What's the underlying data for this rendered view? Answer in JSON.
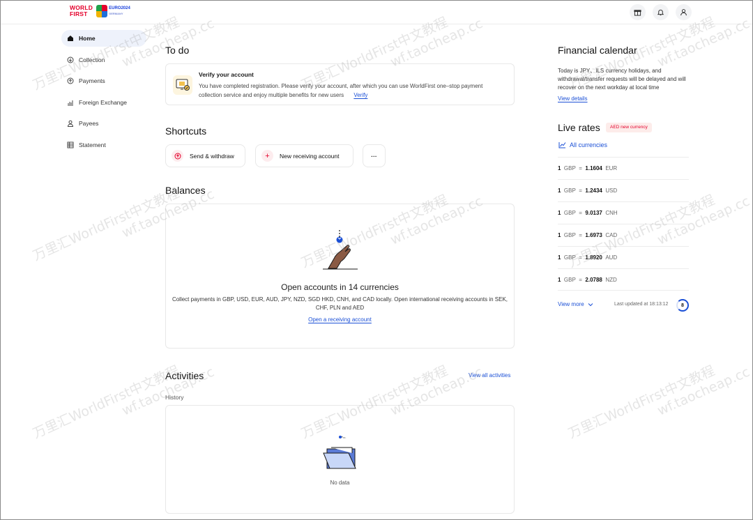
{
  "header": {
    "logo_line1": "WORLD",
    "logo_line2": "FIRST",
    "euro_line1": "EURO2024",
    "euro_line2": "GERMANY"
  },
  "sidebar": {
    "items": [
      {
        "label": "Home"
      },
      {
        "label": "Collection"
      },
      {
        "label": "Payments"
      },
      {
        "label": "Foreign Exchange"
      },
      {
        "label": "Payees"
      },
      {
        "label": "Statement"
      }
    ]
  },
  "todo": {
    "title": "To do",
    "item_title": "Verify your account",
    "item_desc": "You have completed registration. Please verify your account, after which you can use WorldFirst one–stop payment collection service and enjoy multiple benefits for new users",
    "verify_label": "Verify"
  },
  "shortcuts": {
    "title": "Shortcuts",
    "send_withdraw": "Send & withdraw",
    "new_receiving": "New receiving account",
    "more": "···"
  },
  "balances": {
    "title": "Balances",
    "headline": "Open accounts in 14 currencies",
    "desc_line1": "Collect payments in GBP, USD, EUR, AUD, JPY, NZD, SGD HKD, CNH, and CAD locally. Open international receiving accounts in SEK,",
    "desc_line2": "CHF, PLN and AED",
    "cta": "Open a receiving account"
  },
  "activities": {
    "title": "Activities",
    "view_all": "View all activities",
    "history": "History",
    "empty": "No data"
  },
  "calendar": {
    "title": "Financial calendar",
    "text": "Today is JPY、ILS currency holidays, and withdrawal/transfer requests will be delayed and will recover on the next workday at local time",
    "view_details": "View details"
  },
  "rates": {
    "title": "Live rates",
    "badge": "AED new currency",
    "all_currencies": "All currencies",
    "rows": [
      {
        "amount": "1",
        "base": "GBP",
        "eq": "=",
        "rate": "1.1604",
        "quote": "EUR"
      },
      {
        "amount": "1",
        "base": "GBP",
        "eq": "=",
        "rate": "1.2434",
        "quote": "USD"
      },
      {
        "amount": "1",
        "base": "GBP",
        "eq": "=",
        "rate": "9.0137",
        "quote": "CNH"
      },
      {
        "amount": "1",
        "base": "GBP",
        "eq": "=",
        "rate": "1.6973",
        "quote": "CAD"
      },
      {
        "amount": "1",
        "base": "GBP",
        "eq": "=",
        "rate": "1.8920",
        "quote": "AUD"
      },
      {
        "amount": "1",
        "base": "GBP",
        "eq": "=",
        "rate": "2.0788",
        "quote": "NZD"
      }
    ],
    "view_more": "View more",
    "last_updated": "Last updated at 18:13:12",
    "countdown": "8"
  },
  "watermark": {
    "line1": "万里汇WorldFirst中文教程",
    "line2": "wf.taocheap.cc"
  },
  "colors": {
    "brand_red": "#e4002b",
    "link_blue": "#1a4fd6",
    "nav_active_bg": "#eef2fb"
  }
}
